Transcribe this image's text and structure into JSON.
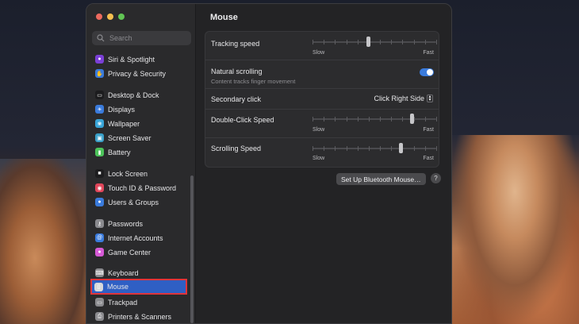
{
  "search": {
    "placeholder": "Search"
  },
  "sidebar": {
    "items": [
      {
        "label": "Siri & Spotlight",
        "icon": "siri-icon",
        "color": "#7b3fd6"
      },
      {
        "label": "Privacy & Security",
        "icon": "hand-icon",
        "color": "#3a7bdc"
      },
      {
        "label": "Desktop & Dock",
        "icon": "dock-icon",
        "color": "#1c1c1e"
      },
      {
        "label": "Displays",
        "icon": "sun-icon",
        "color": "#3a7bdc"
      },
      {
        "label": "Wallpaper",
        "icon": "wallpaper-icon",
        "color": "#39a5d8"
      },
      {
        "label": "Screen Saver",
        "icon": "screensaver-icon",
        "color": "#3aa0c8"
      },
      {
        "label": "Battery",
        "icon": "battery-icon",
        "color": "#4cc35a"
      },
      {
        "label": "Lock Screen",
        "icon": "lock-icon",
        "color": "#1c1c1e"
      },
      {
        "label": "Touch ID & Password",
        "icon": "fingerprint-icon",
        "color": "#e0465a"
      },
      {
        "label": "Users & Groups",
        "icon": "users-icon",
        "color": "#3a7bdc"
      },
      {
        "label": "Passwords",
        "icon": "key-icon",
        "color": "#8a8a8e"
      },
      {
        "label": "Internet Accounts",
        "icon": "at-icon",
        "color": "#3a7bdc"
      },
      {
        "label": "Game Center",
        "icon": "gamecenter-icon",
        "color": "#d65ad6"
      },
      {
        "label": "Keyboard",
        "icon": "keyboard-icon",
        "color": "#8a8a8e"
      },
      {
        "label": "Mouse",
        "icon": "mouse-icon",
        "color": "#d8d8da"
      },
      {
        "label": "Trackpad",
        "icon": "trackpad-icon",
        "color": "#8a8a8e"
      },
      {
        "label": "Printers & Scanners",
        "icon": "printer-icon",
        "color": "#8a8a8e"
      }
    ],
    "selected": "Mouse"
  },
  "main": {
    "title": "Mouse",
    "tracking_speed": {
      "label": "Tracking speed",
      "min_label": "Slow",
      "max_label": "Fast",
      "value_fraction": 0.45
    },
    "natural_scrolling": {
      "label": "Natural scrolling",
      "sublabel": "Content tracks finger movement",
      "enabled": true
    },
    "secondary_click": {
      "label": "Secondary click",
      "value": "Click Right Side"
    },
    "double_click_speed": {
      "label": "Double-Click Speed",
      "min_label": "Slow",
      "max_label": "Fast",
      "value_fraction": 0.8
    },
    "scrolling_speed": {
      "label": "Scrolling Speed",
      "min_label": "Slow",
      "max_label": "Fast",
      "value_fraction": 0.71
    },
    "bluetooth_button": "Set Up Bluetooth Mouse…",
    "help_label": "?"
  },
  "colors": {
    "accent": "#3a7bdc",
    "highlight_border": "#e0343a"
  }
}
